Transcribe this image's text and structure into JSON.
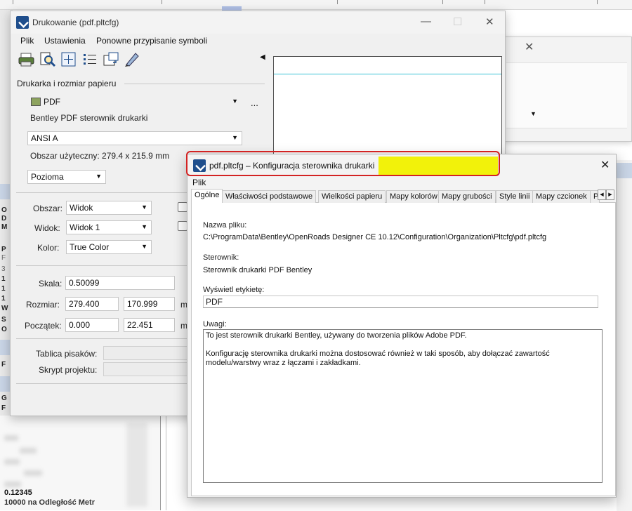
{
  "print_dialog": {
    "title": "Drukowanie (pdf.pltcfg)",
    "menu": [
      "Plik",
      "Ustawienia",
      "Ponowne przypisanie symboli"
    ],
    "toolbar_icons": [
      "printer-icon",
      "preview-icon",
      "fit-icon",
      "list-icon",
      "rotate-icon",
      "pen-icon"
    ],
    "printer_section_label": "Drukarka i rozmiar papieru",
    "printer": "PDF",
    "printer_more": "...",
    "driver_name": "Bentley PDF sterownik drukarki",
    "paper_size": "ANSI A",
    "usable_area": "Obszar użyteczny: 279.4 x 215.9 mm",
    "orientation": "Pozioma",
    "area_label": "Obszar:",
    "area_value": "Widok",
    "view_label": "Widok:",
    "view_value": "Widok 1",
    "color_label": "Kolor:",
    "color_value": "True Color",
    "scale_label": "Skala:",
    "scale_value": "0.50099",
    "scale_suffix": ".",
    "size_label": "Rozmiar:",
    "size_w": "279.400",
    "size_h": "170.999",
    "size_unit": "m",
    "origin_label": "Początek:",
    "origin_x": "0.000",
    "origin_y": "22.451",
    "origin_unit": "m",
    "pen_table_label": "Tablica pisaków:",
    "pen_table_value": "",
    "project_script_label": "Skrypt projektu:",
    "project_script_value": ""
  },
  "config_dialog": {
    "title": "pdf.pltcfg – Konfiguracja sterownika drukarki",
    "menu": "Plik",
    "tabs": [
      "Ogólne",
      "Właściwości podstawowe",
      "Wielkości papieru",
      "Mapy kolorów",
      "Mapy grubości",
      "Style linii",
      "Mapy czcionek",
      "P"
    ],
    "active_tab": "Ogólne",
    "filename_label": "Nazwa pliku:",
    "filename_value": "C:\\ProgramData\\Bentley\\OpenRoads Designer CE 10.12\\Configuration\\Organization\\Pltcfg\\pdf.pltcfg",
    "driver_label": "Sterownik:",
    "driver_value": "Sterownik drukarki PDF Bentley",
    "display_label": "Wyświetl etykietę:",
    "display_value": "PDF",
    "notes_label": "Uwagi:",
    "notes_line1": "To jest sterownik drukarki Bentley, używany do tworzenia plików Adobe PDF.",
    "notes_line2": "Konfigurację sterownika drukarki można dostosować również w taki sposób, aby dołączać zawartość modelu/warstwy wraz z łączami i zakładkami."
  },
  "background": {
    "left_rows": [
      "O",
      "D",
      "M",
      "P",
      "F",
      "3",
      "1",
      "1",
      "1",
      "W",
      "S",
      "O",
      "F",
      "G",
      "F"
    ],
    "bottom_value": "0.12345",
    "bottom_caption": "10000 na Odległość Metr"
  },
  "colors": {
    "highlight_red": "#d32323",
    "highlight_yellow": "#f2f20a",
    "preview_line": "#39c2d6"
  }
}
